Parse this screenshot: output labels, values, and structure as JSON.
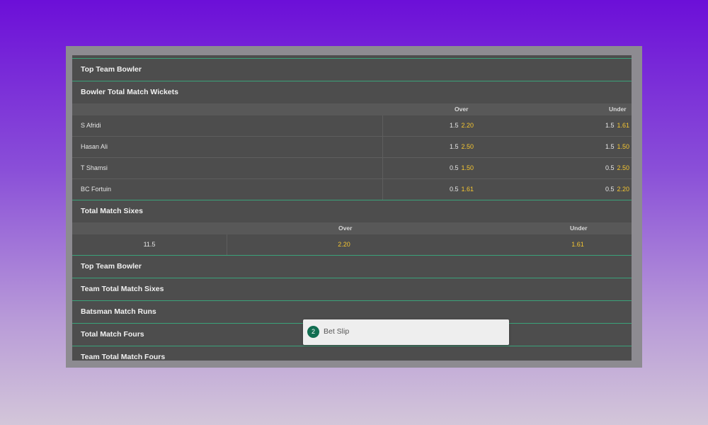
{
  "sections": {
    "top_team_bowler_1": "Top Team Bowler",
    "bowler_wickets": "Bowler Total Match Wickets",
    "total_sixes": "Total Match Sixes",
    "top_team_bowler_2": "Top Team Bowler",
    "team_total_sixes": "Team Total Match Sixes",
    "batsman_runs": "Batsman Match Runs",
    "total_fours": "Total Match Fours",
    "team_total_fours": "Team Total Match Fours"
  },
  "wickets": {
    "col_over": "Over",
    "col_under": "Under",
    "rows": [
      {
        "name": "S Afridi",
        "over_line": "1.5",
        "over_price": "2.20",
        "under_line": "1.5",
        "under_price": "1.61"
      },
      {
        "name": "Hasan Ali",
        "over_line": "1.5",
        "over_price": "2.50",
        "under_line": "1.5",
        "under_price": "1.50"
      },
      {
        "name": "T Shamsi",
        "over_line": "0.5",
        "over_price": "1.50",
        "under_line": "0.5",
        "under_price": "2.50"
      },
      {
        "name": "BC Fortuin",
        "over_line": "0.5",
        "over_price": "1.61",
        "under_line": "0.5",
        "under_price": "2.20"
      }
    ]
  },
  "sixes": {
    "col_over": "Over",
    "col_under": "Under",
    "line": "11.5",
    "over_price": "2.20",
    "under_price": "1.61"
  },
  "bet_slip": {
    "count": "2",
    "label": "Bet Slip"
  },
  "colors": {
    "accent_green": "#3aa27a",
    "odds_yellow": "#f4c531",
    "panel_bg": "#4d4d4d",
    "badge_green": "#126e51"
  }
}
